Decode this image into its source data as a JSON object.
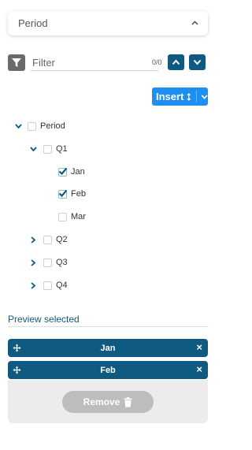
{
  "header": {
    "title": "Period",
    "chevron": "^"
  },
  "filter": {
    "placeholder": "Filter",
    "value": "",
    "counter": "0/0"
  },
  "insert": {
    "label": "Insert"
  },
  "tree": {
    "root": {
      "label": "Period",
      "checked": false,
      "expanded": true
    },
    "q1": {
      "label": "Q1",
      "checked": false,
      "expanded": true
    },
    "jan": {
      "label": "Jan",
      "checked": true
    },
    "feb": {
      "label": "Feb",
      "checked": true
    },
    "mar": {
      "label": "Mar",
      "checked": false
    },
    "q2": {
      "label": "Q2",
      "checked": false,
      "expanded": false
    },
    "q3": {
      "label": "Q3",
      "checked": false,
      "expanded": false
    },
    "q4": {
      "label": "Q4",
      "checked": false,
      "expanded": false
    }
  },
  "preview": {
    "title": "Preview selected",
    "items": [
      {
        "label": "Jan"
      },
      {
        "label": "Feb"
      }
    ],
    "close_glyph": "×",
    "remove_label": "Remove"
  },
  "colors": {
    "primary": "#0e5a80",
    "accent": "#1e8ff0",
    "muted": "#bdbdbd"
  }
}
